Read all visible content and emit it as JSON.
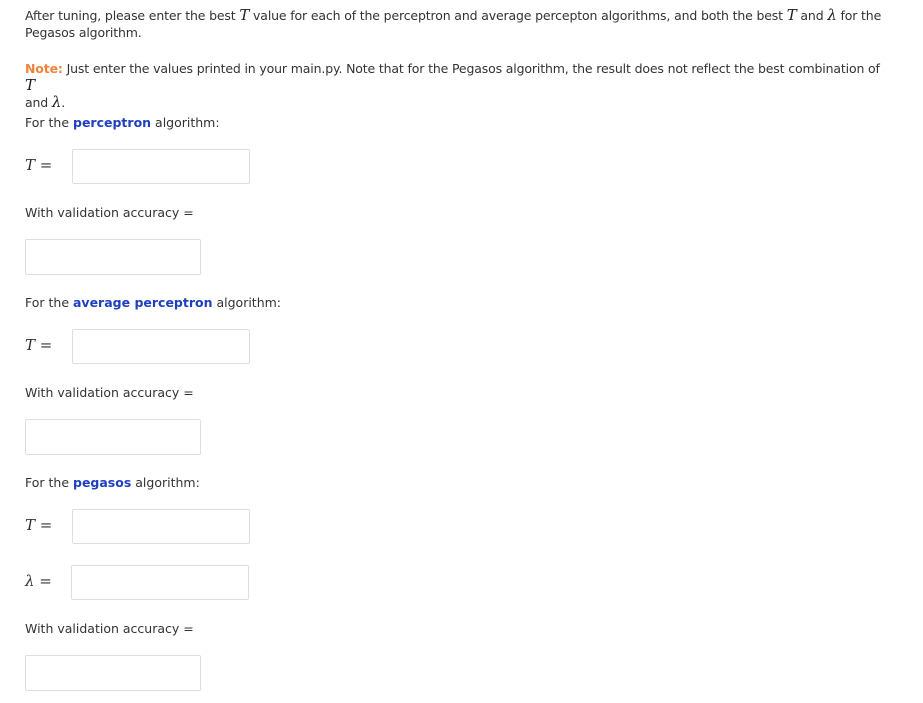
{
  "intro": {
    "part1": "After tuning, please enter the best ",
    "T": "T",
    "part2": " value for each of the perceptron and average percepton algorithms, and both the best ",
    "T2": "T",
    "and": " and ",
    "lambda": "λ",
    "part3": " for the Pegasos algorithm."
  },
  "note": {
    "label": "Note:",
    "text": " Just enter the values printed in your main.py. Note that for the Pegasos algorithm, the result does not reflect the best combination of ",
    "T": "T",
    "and": " and ",
    "lambda": "λ",
    "end": "."
  },
  "sections": [
    {
      "prefix": "For the ",
      "algorithm": "perceptron",
      "suffix": " algorithm:",
      "T_label": "T",
      "eq": " =",
      "T_value": "",
      "accuracy_label": "With validation accuracy =",
      "accuracy_value": ""
    },
    {
      "prefix": "For the ",
      "algorithm": "average perceptron",
      "suffix": " algorithm:",
      "T_label": "T",
      "eq": " =",
      "T_value": "",
      "accuracy_label": "With validation accuracy =",
      "accuracy_value": ""
    },
    {
      "prefix": "For the ",
      "algorithm": "pegasos",
      "suffix": " algorithm:",
      "T_label": "T",
      "eq": " =",
      "T_value": "",
      "lambda_label": "λ",
      "lambda_value": "",
      "accuracy_label": "With validation accuracy =",
      "accuracy_value": ""
    }
  ],
  "colors": {
    "note": "#f0833a",
    "algorithm_highlight": "#1e3fbf",
    "text": "#333333",
    "input_border": "#dedede"
  }
}
